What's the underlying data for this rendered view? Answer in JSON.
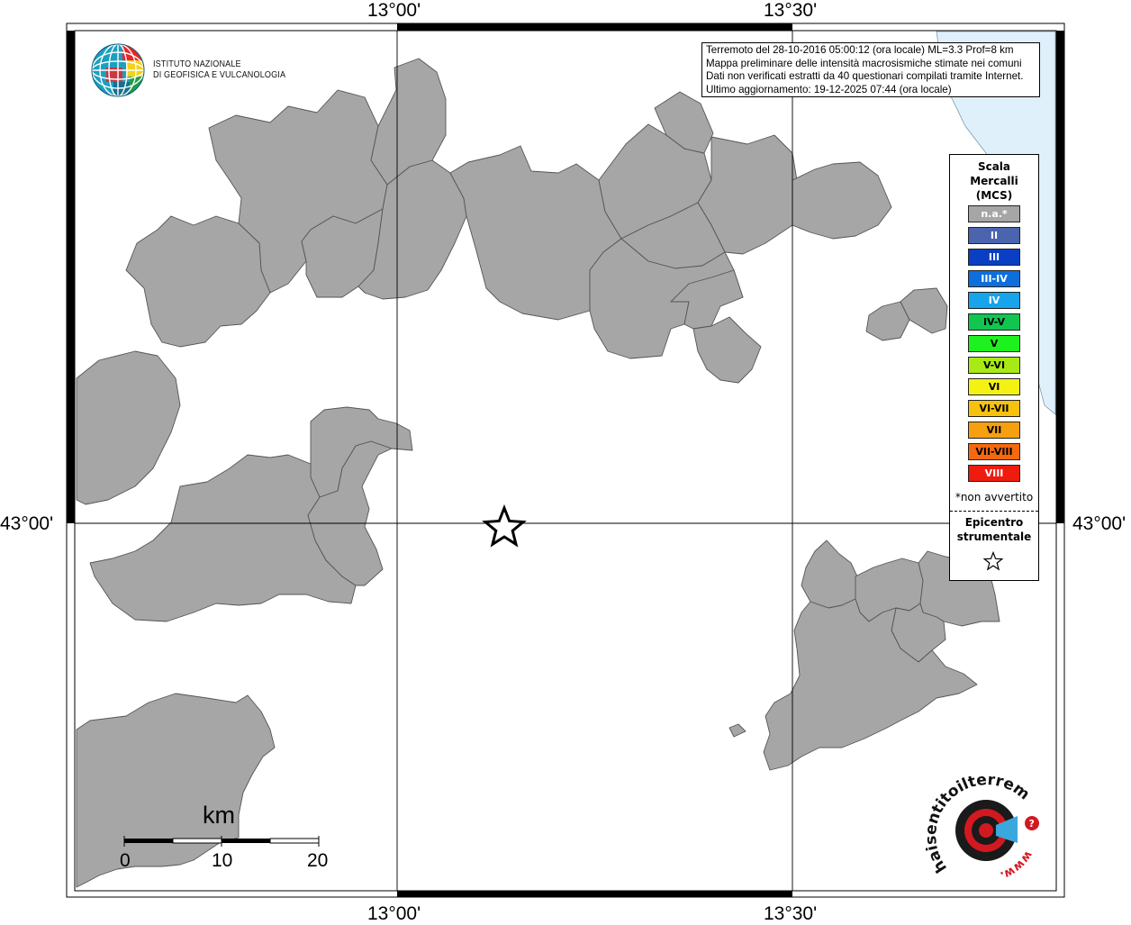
{
  "map": {
    "lon_labels": [
      "13°00'",
      "13°30'"
    ],
    "lat_labels": [
      "43°00'"
    ]
  },
  "institute": {
    "line1": "ISTITUTO NAZIONALE",
    "line2": "DI GEOFISICA E VULCANOLOGIA"
  },
  "info": {
    "lines": [
      "Terremoto del 28-10-2016 05:00:12 (ora locale) ML=3.3 Prof=8 km",
      "Mappa preliminare delle intensità macrosismiche stimate nei comuni",
      "Dati non verificati estratti da 40 questionari compilati tramite Internet.",
      "Ultimo aggiornamento: 19-12-2025 07:44 (ora locale)"
    ]
  },
  "legend": {
    "title": [
      "Scala",
      "Mercalli",
      "(MCS)"
    ],
    "items": [
      {
        "label": "n.a.*",
        "color": "#a6a6a6",
        "text_color": "#ffffff"
      },
      {
        "label": "II",
        "color": "#4a64ae",
        "text_color": "#ffffff"
      },
      {
        "label": "III",
        "color": "#0a3fc4",
        "text_color": "#ffffff"
      },
      {
        "label": "III-IV",
        "color": "#0d6fdc",
        "text_color": "#ffffff"
      },
      {
        "label": "IV",
        "color": "#16a4ea",
        "text_color": "#ffffff"
      },
      {
        "label": "IV-V",
        "color": "#10c651",
        "text_color": "#000000"
      },
      {
        "label": "V",
        "color": "#1ef21e",
        "text_color": "#000000"
      },
      {
        "label": "V-VI",
        "color": "#a8ea16",
        "text_color": "#000000"
      },
      {
        "label": "VI",
        "color": "#f4f212",
        "text_color": "#000000"
      },
      {
        "label": "VI-VII",
        "color": "#f6c20d",
        "text_color": "#000000"
      },
      {
        "label": "VII",
        "color": "#f6a00f",
        "text_color": "#000000"
      },
      {
        "label": "VII-VIII",
        "color": "#f4690f",
        "text_color": "#000000"
      },
      {
        "label": "VIII",
        "color": "#ee1b0e",
        "text_color": "#ffffff"
      }
    ],
    "note": "*non avvertito",
    "epicenter_title": [
      "Epicentro",
      "strumentale"
    ]
  },
  "scale_bar": {
    "unit": "km",
    "ticks": [
      "0",
      "10",
      "20"
    ]
  },
  "brand": {
    "text": "haisentitoilterremoto.it",
    "prefix": "www."
  },
  "colors": {
    "land_area": "#a6a6a6",
    "sea": "#e0f0fb",
    "frame": "#000000"
  }
}
